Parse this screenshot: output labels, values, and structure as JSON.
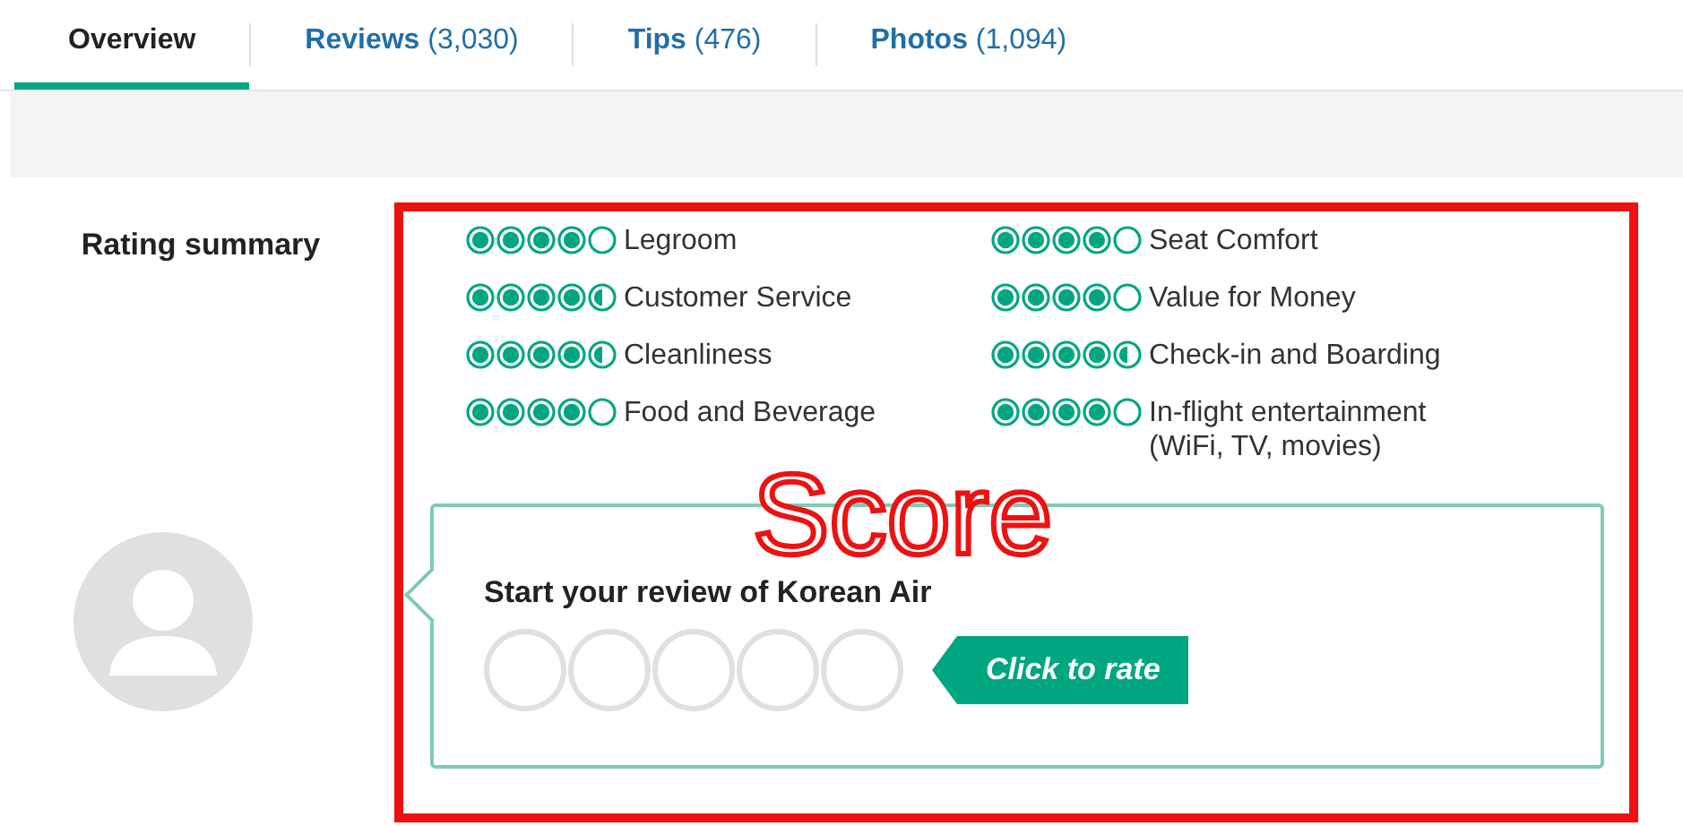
{
  "tabs": [
    {
      "label": "Overview",
      "selected": true
    },
    {
      "label": "Reviews",
      "count": "(3,030)",
      "selected": false
    },
    {
      "label": "Tips",
      "count": "(476)",
      "selected": false
    },
    {
      "label": "Photos",
      "count": "(1,094)",
      "selected": false
    }
  ],
  "rating_summary": {
    "title": "Rating summary",
    "ratings": [
      {
        "label": "Legroom",
        "stars": 4
      },
      {
        "label": "Seat Comfort",
        "stars": 4
      },
      {
        "label": "Customer Service",
        "stars": 4.5
      },
      {
        "label": "Value for Money",
        "stars": 4
      },
      {
        "label": "Cleanliness",
        "stars": 4.5
      },
      {
        "label": "Check-in and Boarding",
        "stars": 4.5
      },
      {
        "label": "Food and Beverage",
        "stars": 4
      },
      {
        "label": "In-flight entertainment (WiFi, TV, movies)",
        "stars": 4
      }
    ]
  },
  "review_prompt": {
    "title": "Start your review of Korean Air",
    "stars": 0,
    "button": "Click to rate"
  },
  "annotation": {
    "text": "Score"
  }
}
